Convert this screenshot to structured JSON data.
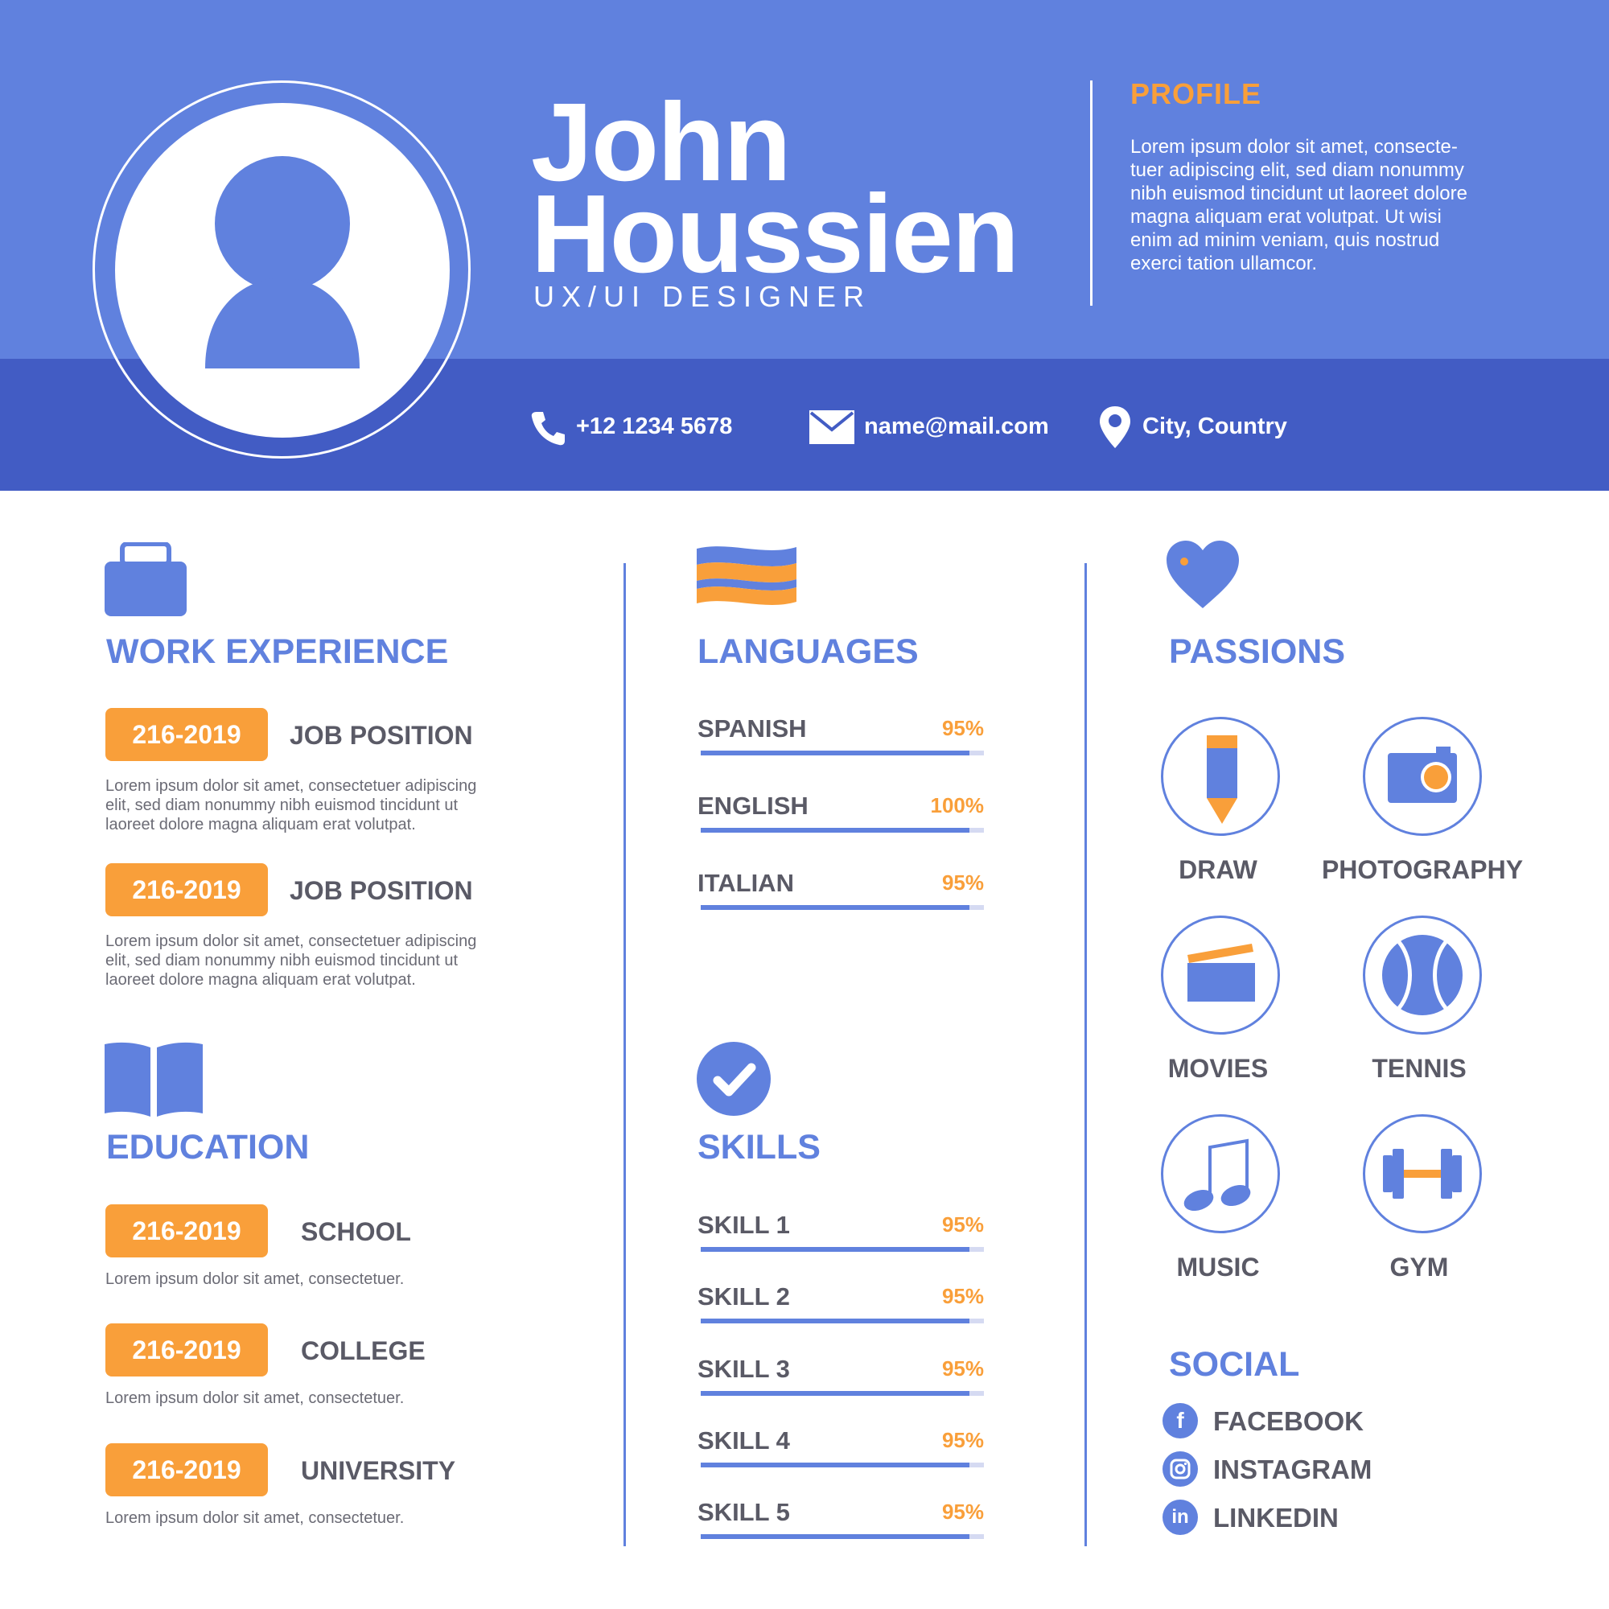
{
  "header": {
    "first_name": "John",
    "last_name": "Houssien",
    "role": "UX/UI DESIGNER",
    "profile_title": "PROFILE",
    "profile_lines": [
      "Lorem ipsum dolor sit amet, consecte-",
      "tuer adipiscing elit, sed diam nonummy",
      "nibh euismod tincidunt ut laoreet dolore",
      "magna aliquam erat volutpat. Ut wisi",
      "enim ad minim veniam, quis nostrud",
      "exerci tation ullamcor."
    ],
    "contacts": [
      {
        "icon": "phone-icon",
        "text": "+12 1234 5678"
      },
      {
        "icon": "mail-icon",
        "text": "name@mail.com"
      },
      {
        "icon": "location-pin-icon",
        "text": "City, Country"
      }
    ]
  },
  "work": {
    "title": "WORK EXPERIENCE",
    "items": [
      {
        "period": "216-2019",
        "label": "JOB POSITION",
        "desc": [
          "Lorem ipsum dolor sit amet, consectetuer adipiscing",
          "elit, sed diam nonummy nibh euismod tincidunt ut",
          "laoreet dolore magna aliquam erat volutpat."
        ]
      },
      {
        "period": "216-2019",
        "label": "JOB POSITION",
        "desc": [
          "Lorem ipsum dolor sit amet, consectetuer adipiscing",
          "elit, sed diam nonummy nibh euismod tincidunt ut",
          "laoreet dolore magna aliquam erat volutpat."
        ]
      }
    ]
  },
  "education": {
    "title": "EDUCATION",
    "items": [
      {
        "period": "216-2019",
        "label": "SCHOOL",
        "desc": "Lorem ipsum dolor sit amet, consectetuer."
      },
      {
        "period": "216-2019",
        "label": "COLLEGE",
        "desc": "Lorem ipsum dolor sit amet, consectetuer."
      },
      {
        "period": "216-2019",
        "label": "UNIVERSITY",
        "desc": "Lorem ipsum dolor sit amet, consectetuer."
      }
    ]
  },
  "languages": {
    "title": "LANGUAGES",
    "items": [
      {
        "label": "SPANISH",
        "pct_text": "95%",
        "level": 0.95
      },
      {
        "label": "ENGLISH",
        "pct_text": "100%",
        "level": 0.95
      },
      {
        "label": "ITALIAN",
        "pct_text": "95%",
        "level": 0.95
      }
    ]
  },
  "skills": {
    "title": "SKILLS",
    "items": [
      {
        "label": "SKILL 1",
        "pct_text": "95%",
        "level": 0.95
      },
      {
        "label": "SKILL 2",
        "pct_text": "95%",
        "level": 0.95
      },
      {
        "label": "SKILL 3",
        "pct_text": "95%",
        "level": 0.95
      },
      {
        "label": "SKILL 4",
        "pct_text": "95%",
        "level": 0.95
      },
      {
        "label": "SKILL 5",
        "pct_text": "95%",
        "level": 0.95
      }
    ]
  },
  "passions": {
    "title": "PASSIONS",
    "items": [
      {
        "label": "DRAW",
        "icon": "pencil-icon"
      },
      {
        "label": "PHOTOGRAPHY",
        "icon": "camera-icon"
      },
      {
        "label": "MOVIES",
        "icon": "clapperboard-icon"
      },
      {
        "label": "TENNIS",
        "icon": "tennis-ball-icon"
      },
      {
        "label": "MUSIC",
        "icon": "music-note-icon"
      },
      {
        "label": "GYM",
        "icon": "dumbbell-icon"
      }
    ]
  },
  "social": {
    "title": "SOCIAL",
    "items": [
      {
        "label": "FACEBOOK",
        "icon": "facebook-icon"
      },
      {
        "label": "INSTAGRAM",
        "icon": "instagram-icon"
      },
      {
        "label": "LINKEDIN",
        "icon": "linkedin-icon"
      }
    ]
  },
  "colors": {
    "accent": "#6081de",
    "accent_dark": "#425cc4",
    "orange": "#f99f3a",
    "text": "#5a5a66"
  }
}
